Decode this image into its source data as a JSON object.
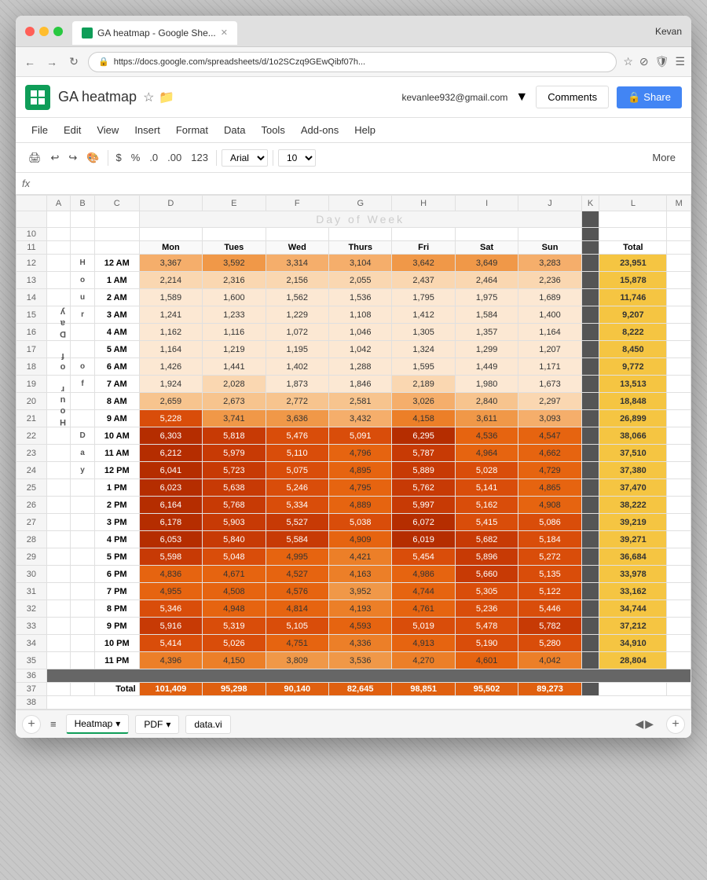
{
  "browser": {
    "tab_title": "GA heatmap - Google She...",
    "url": "https://docs.google.com/spreadsheets/d/1o2SCzq9GEwQibf07h...",
    "user": "Kevan"
  },
  "app": {
    "title": "GA heatmap",
    "user_email": "kevanlee932@gmail.com",
    "comments_label": "Comments",
    "share_label": "Share"
  },
  "menu": {
    "items": [
      "File",
      "Edit",
      "View",
      "Insert",
      "Format",
      "Data",
      "Tools",
      "Add-ons",
      "Help"
    ]
  },
  "toolbar": {
    "font": "Arial",
    "font_size": "10",
    "more_label": "More"
  },
  "spreadsheet": {
    "col_headers": [
      "",
      "A",
      "B",
      "C",
      "D",
      "E",
      "F",
      "G",
      "H",
      "I",
      "J",
      "K",
      "L",
      "M"
    ],
    "day_of_week_label": "Day of Week",
    "days": [
      "Mon",
      "Tues",
      "Wed",
      "Thurs",
      "Fri",
      "Sat",
      "Sun"
    ],
    "total_label": "Total",
    "hour_label": "Hour of Day",
    "hours": [
      "12 AM",
      "1 AM",
      "2 AM",
      "3 AM",
      "4 AM",
      "5 AM",
      "6 AM",
      "7 AM",
      "8 AM",
      "9 AM",
      "10 AM",
      "11 AM",
      "12 PM",
      "1 PM",
      "2 PM",
      "3 PM",
      "4 PM",
      "5 PM",
      "6 PM",
      "7 PM",
      "8 PM",
      "9 PM",
      "10 PM",
      "11 PM"
    ],
    "data": [
      [
        3367,
        3592,
        3314,
        3104,
        3642,
        3649,
        3283,
        23951
      ],
      [
        2214,
        2316,
        2156,
        2055,
        2437,
        2464,
        2236,
        15878
      ],
      [
        1589,
        1600,
        1562,
        1536,
        1795,
        1975,
        1689,
        11746
      ],
      [
        1241,
        1233,
        1229,
        1108,
        1412,
        1584,
        1400,
        9207
      ],
      [
        1162,
        1116,
        1072,
        1046,
        1305,
        1357,
        1164,
        8222
      ],
      [
        1164,
        1219,
        1195,
        1042,
        1324,
        1299,
        1207,
        8450
      ],
      [
        1426,
        1441,
        1402,
        1288,
        1595,
        1449,
        1171,
        9772
      ],
      [
        1924,
        2028,
        1873,
        1846,
        2189,
        1980,
        1673,
        13513
      ],
      [
        2659,
        2673,
        2772,
        2581,
        3026,
        2840,
        2297,
        18848
      ],
      [
        5228,
        3741,
        3636,
        3432,
        4158,
        3611,
        3093,
        26899
      ],
      [
        6303,
        5818,
        5476,
        5091,
        6295,
        4536,
        4547,
        38066
      ],
      [
        6212,
        5979,
        5110,
        4796,
        5787,
        4964,
        4662,
        37510
      ],
      [
        6041,
        5723,
        5075,
        4895,
        5889,
        5028,
        4729,
        37380
      ],
      [
        6023,
        5638,
        5246,
        4795,
        5762,
        5141,
        4865,
        37470
      ],
      [
        6164,
        5768,
        5334,
        4889,
        5997,
        5162,
        4908,
        38222
      ],
      [
        6178,
        5903,
        5527,
        5038,
        6072,
        5415,
        5086,
        39219
      ],
      [
        6053,
        5840,
        5584,
        4909,
        6019,
        5682,
        5184,
        39271
      ],
      [
        5598,
        5048,
        4995,
        4421,
        5454,
        5896,
        5272,
        36684
      ],
      [
        4836,
        4671,
        4527,
        4163,
        4986,
        5660,
        5135,
        33978
      ],
      [
        4955,
        4508,
        4576,
        3952,
        4744,
        5305,
        5122,
        33162
      ],
      [
        5346,
        4948,
        4814,
        4193,
        4761,
        5236,
        5446,
        34744
      ],
      [
        5916,
        5319,
        5105,
        4593,
        5019,
        5478,
        5782,
        37212
      ],
      [
        5414,
        5026,
        4751,
        4336,
        4913,
        5190,
        5280,
        34910
      ],
      [
        4396,
        4150,
        3809,
        3536,
        4270,
        4601,
        4042,
        28804
      ]
    ],
    "totals": [
      101409,
      95298,
      90140,
      82645,
      98851,
      95502,
      89273
    ],
    "row_numbers": [
      10,
      11,
      12,
      13,
      14,
      15,
      16,
      17,
      18,
      19,
      20,
      21,
      22,
      23,
      24,
      25,
      26,
      27,
      28,
      29,
      30,
      31,
      32,
      33,
      34,
      35,
      36,
      37,
      38
    ]
  },
  "bottom_tabs": {
    "sheets": [
      "Heatmap",
      "PDF",
      "data.vi"
    ]
  }
}
